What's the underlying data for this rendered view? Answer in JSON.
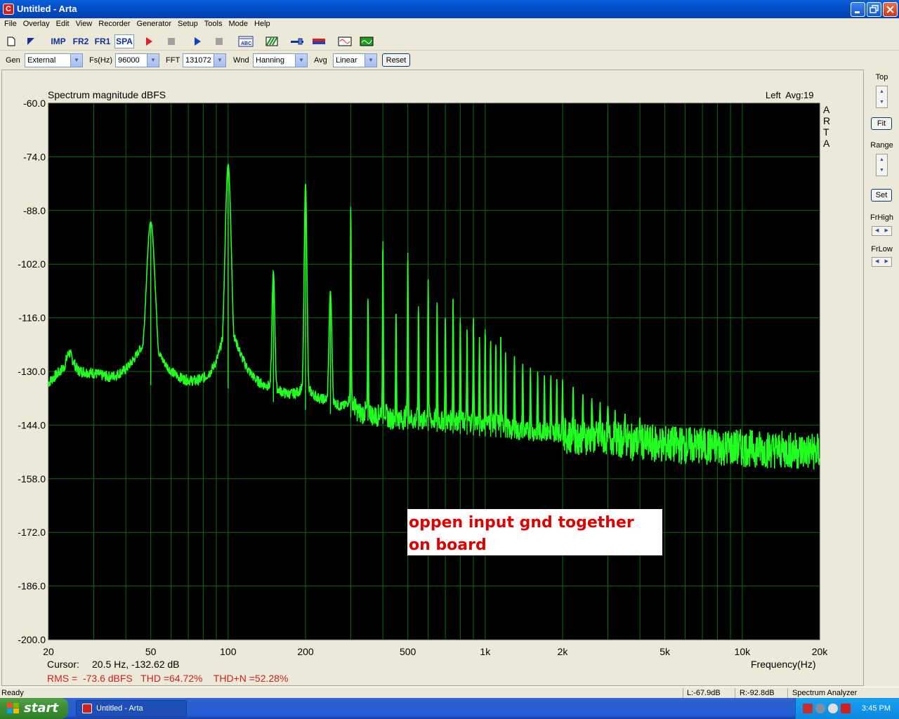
{
  "window": {
    "title": "Untitled - Arta",
    "app_icon_letter": "C"
  },
  "menu": [
    "File",
    "Overlay",
    "Edit",
    "View",
    "Recorder",
    "Generator",
    "Setup",
    "Tools",
    "Mode",
    "Help"
  ],
  "toolbar": {
    "imp": "IMP",
    "fr2": "FR2",
    "fr1": "FR1",
    "spa": "SPA"
  },
  "controls": {
    "gen_label": "Gen",
    "gen_value": "External",
    "fs_label": "Fs(Hz)",
    "fs_value": "96000",
    "fft_label": "FFT",
    "fft_value": "131072",
    "wnd_label": "Wnd",
    "wnd_value": "Hanning",
    "avg_label": "Avg",
    "avg_value": "Linear",
    "reset_label": "Reset"
  },
  "right_panel": {
    "top_label": "Top",
    "fit_label": "Fit",
    "range_label": "Range",
    "set_label": "Set",
    "frhigh_label": "FrHigh",
    "frlow_label": "FrLow"
  },
  "plot": {
    "title": "Spectrum magnitude dBFS",
    "channel_info": "Left  Avg:19",
    "brand": "ARTA",
    "cursor_label": "Cursor:",
    "cursor_value": "20.5 Hz, -132.62 dB",
    "stats": "RMS =  -73.6 dBFS   THD =64.72%    THD+N =52.28%",
    "annotation_line1": "oppen input gnd together",
    "annotation_line2": "on board",
    "colors": {
      "trace": "#20ff20",
      "grid": "#0b6e0b",
      "background": "#000000",
      "stats": "#cc2020",
      "annotation": "#e00000"
    }
  },
  "chart_data": {
    "type": "line",
    "title": "Spectrum magnitude dBFS",
    "xlabel": "Frequency(Hz)",
    "ylabel": "",
    "xscale": "log",
    "xlim": [
      20,
      20000
    ],
    "ylim": [
      -200,
      -60
    ],
    "x_ticks": [
      "20",
      "50",
      "100",
      "200",
      "500",
      "1k",
      "2k",
      "5k",
      "10k",
      "20k"
    ],
    "x_tick_values": [
      20,
      50,
      100,
      200,
      500,
      1000,
      2000,
      5000,
      10000,
      20000
    ],
    "y_ticks": [
      "-60.0",
      "-74.0",
      "-88.0",
      "-102.0",
      "-116.0",
      "-130.0",
      "-144.0",
      "-158.0",
      "-172.0",
      "-186.0",
      "-200.0"
    ],
    "y_tick_values": [
      -60,
      -74,
      -88,
      -102,
      -116,
      -130,
      -144,
      -158,
      -172,
      -186,
      -200
    ],
    "grid": true,
    "series": [
      {
        "values_note_free": true,
        "floor": [
          [
            20,
            -133
          ],
          [
            23,
            -129
          ],
          [
            24,
            -125
          ],
          [
            26,
            -130
          ],
          [
            30,
            -131
          ],
          [
            35,
            -133
          ],
          [
            40,
            -133
          ],
          [
            45,
            -132
          ],
          [
            55,
            -135
          ],
          [
            70,
            -135
          ],
          [
            90,
            -136
          ],
          [
            110,
            -133
          ],
          [
            150,
            -138
          ],
          [
            200,
            -140
          ],
          [
            300,
            -142
          ],
          [
            500,
            -145
          ],
          [
            1000,
            -147
          ],
          [
            2000,
            -148
          ],
          [
            5000,
            -149
          ],
          [
            10000,
            -150
          ],
          [
            20000,
            -151
          ]
        ],
        "peaks": [
          [
            50,
            -91
          ],
          [
            100,
            -76
          ],
          [
            150,
            -104
          ],
          [
            200,
            -81
          ],
          [
            250,
            -109
          ],
          [
            300,
            -87
          ],
          [
            350,
            -111
          ],
          [
            400,
            -96
          ],
          [
            450,
            -115
          ],
          [
            500,
            -99
          ],
          [
            550,
            -113
          ],
          [
            600,
            -106
          ],
          [
            650,
            -112
          ],
          [
            700,
            -116
          ],
          [
            750,
            -111
          ],
          [
            800,
            -116
          ],
          [
            850,
            -119
          ],
          [
            900,
            -116
          ],
          [
            950,
            -121
          ],
          [
            1000,
            -119
          ],
          [
            1050,
            -122
          ],
          [
            1100,
            -123
          ],
          [
            1150,
            -121
          ],
          [
            1200,
            -125
          ],
          [
            1300,
            -126
          ],
          [
            1400,
            -128
          ],
          [
            1500,
            -129
          ],
          [
            1600,
            -130
          ],
          [
            1700,
            -131
          ],
          [
            1800,
            -131
          ],
          [
            1900,
            -132
          ],
          [
            2000,
            -132
          ],
          [
            2200,
            -134
          ],
          [
            2400,
            -136
          ],
          [
            2600,
            -137
          ],
          [
            2800,
            -138
          ],
          [
            3000,
            -139
          ],
          [
            3200,
            -140
          ],
          [
            3500,
            -141
          ],
          [
            4000,
            -142
          ]
        ]
      }
    ]
  },
  "status": {
    "left": "Ready",
    "l_level": "L:-67.9dB",
    "r_level": "R:-92.8dB",
    "mode": "Spectrum Analyzer"
  },
  "taskbar": {
    "start": "start",
    "task_item": "Untitled - Arta",
    "clock": "3:45 PM"
  }
}
